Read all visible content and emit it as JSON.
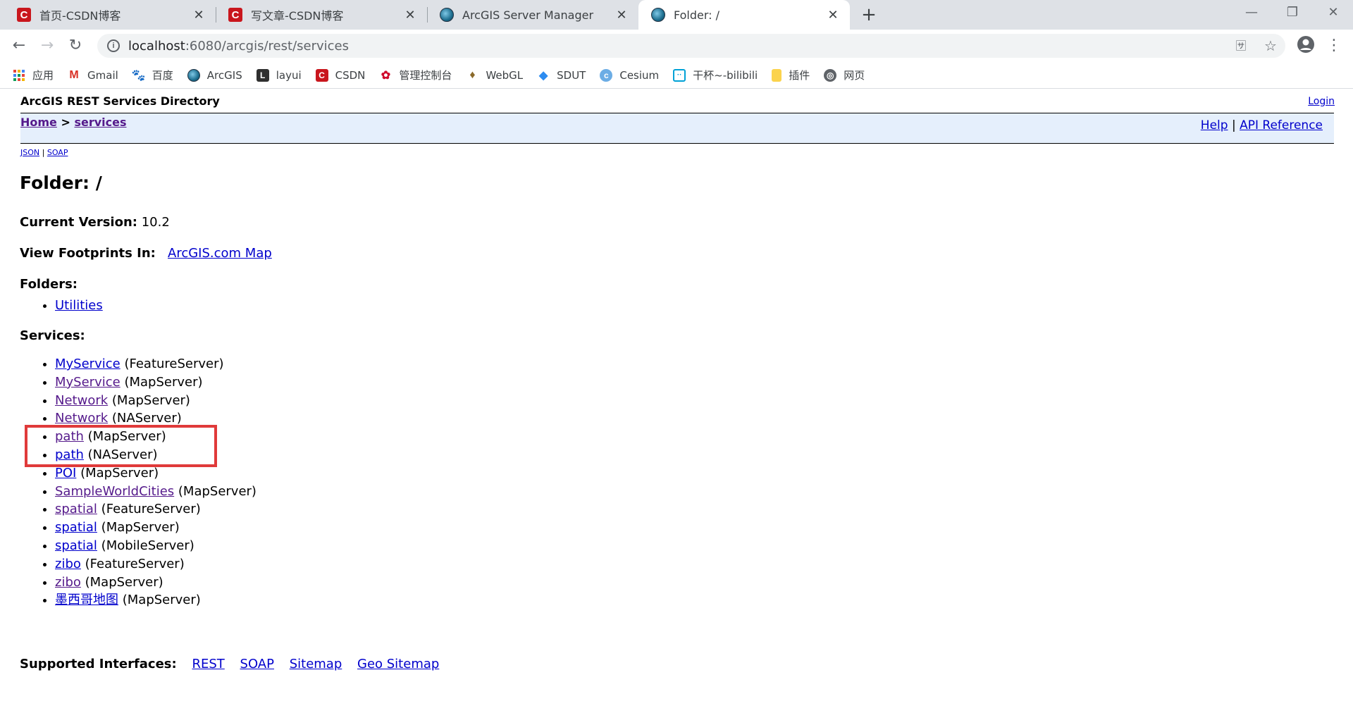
{
  "browser": {
    "tabs": [
      {
        "title": "首页-CSDN博客",
        "icon": "csdn-icon"
      },
      {
        "title": "写文章-CSDN博客",
        "icon": "csdn-icon"
      },
      {
        "title": "ArcGIS Server Manager",
        "icon": "globe-icon"
      },
      {
        "title": "Folder: /",
        "icon": "globe-icon",
        "active": true
      }
    ],
    "address": {
      "host": "localhost",
      "path": ":6080/arcgis/rest/services"
    },
    "bookmarks": [
      {
        "label": "应用",
        "icon": "apps-grid-icon"
      },
      {
        "label": "Gmail",
        "icon": "gmail-icon"
      },
      {
        "label": "百度",
        "icon": "baidu-icon"
      },
      {
        "label": "ArcGIS",
        "icon": "arcgis-globe-icon"
      },
      {
        "label": "layui",
        "icon": "layui-icon"
      },
      {
        "label": "CSDN",
        "icon": "csdn-icon"
      },
      {
        "label": "管理控制台",
        "icon": "huawei-icon"
      },
      {
        "label": "WebGL",
        "icon": "webgl-icon"
      },
      {
        "label": "SDUT",
        "icon": "sdut-icon"
      },
      {
        "label": "Cesium",
        "icon": "cesium-icon"
      },
      {
        "label": "干杯~-bilibili",
        "icon": "bilibili-icon"
      },
      {
        "label": "插件",
        "icon": "folder-icon"
      },
      {
        "label": "网页",
        "icon": "webpage-icon"
      }
    ]
  },
  "page": {
    "header_title": "ArcGIS REST Services Directory",
    "login": "Login",
    "breadcrumb": {
      "home": "Home",
      "sep": ">",
      "current": "services"
    },
    "nav_links": {
      "help": "Help",
      "sep": "|",
      "api": "API Reference"
    },
    "formats": {
      "json": "JSON",
      "sep": "|",
      "soap": "SOAP"
    },
    "folder_title": "Folder: /",
    "current_version_label": "Current Version:",
    "current_version_value": "10.2",
    "footprints_label": "View Footprints In:",
    "footprints_link": "ArcGIS.com Map",
    "folders_heading": "Folders:",
    "folders": [
      "Utilities"
    ],
    "services_heading": "Services:",
    "services": [
      {
        "name": "MyService",
        "type": "(FeatureServer)",
        "visited": false
      },
      {
        "name": "MyService",
        "type": "(MapServer)",
        "visited": true
      },
      {
        "name": "Network",
        "type": "(MapServer)",
        "visited": true
      },
      {
        "name": "Network",
        "type": "(NAServer)",
        "visited": true
      },
      {
        "name": "path",
        "type": "(MapServer)",
        "visited": true
      },
      {
        "name": "path",
        "type": "(NAServer)",
        "visited": false
      },
      {
        "name": "POI",
        "type": "(MapServer)",
        "visited": false
      },
      {
        "name": "SampleWorldCities",
        "type": "(MapServer)",
        "visited": true
      },
      {
        "name": "spatial",
        "type": "(FeatureServer)",
        "visited": true
      },
      {
        "name": "spatial",
        "type": "(MapServer)",
        "visited": false
      },
      {
        "name": "spatial",
        "type": "(MobileServer)",
        "visited": false
      },
      {
        "name": "zibo",
        "type": "(FeatureServer)",
        "visited": false
      },
      {
        "name": "zibo",
        "type": "(MapServer)",
        "visited": true
      },
      {
        "name": "墨西哥地图",
        "type": "(MapServer)",
        "visited": false
      }
    ],
    "supported_label": "Supported Interfaces:",
    "supported": [
      "REST",
      "SOAP",
      "Sitemap",
      "Geo Sitemap"
    ]
  },
  "colors": {
    "link": "#0000cc",
    "visited": "#551a8b",
    "navbar_bg": "#e5effc",
    "highlight": "#e03a3a"
  }
}
